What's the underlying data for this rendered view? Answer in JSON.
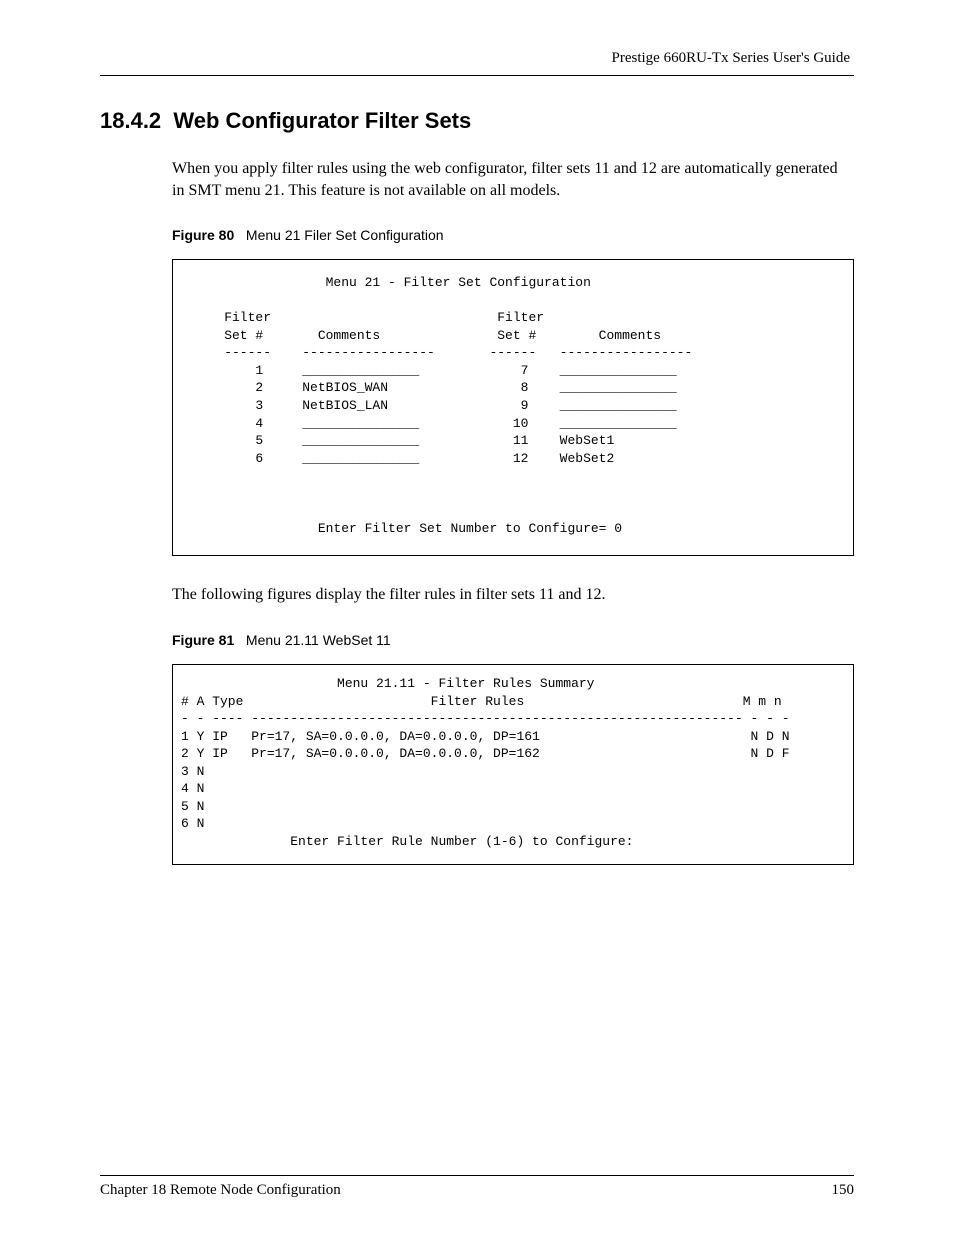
{
  "header": {
    "guide_title": "Prestige 660RU-Tx Series User's Guide"
  },
  "section": {
    "number": "18.4.2",
    "title": "Web Configurator Filter Sets"
  },
  "body": {
    "intro": "When you apply filter rules using the web configurator, filter sets 11 and 12 are automatically generated in SMT menu 21. This feature is not available on all models.",
    "after_fig80": "The following figures display the filter rules in filter sets 11 and 12."
  },
  "figures": {
    "fig80": {
      "label": "Figure 80",
      "caption": "Menu 21 Filer Set Configuration"
    },
    "fig81": {
      "label": "Figure 81",
      "caption": "Menu 21.11 WebSet 11"
    }
  },
  "terminal1": {
    "title": "Menu 21 - Filter Set Configuration",
    "col1_header": "Filter",
    "col1_header2": "Set #",
    "col2_header": "Comments",
    "col3_header": "Filter",
    "col3_header2": "Set #",
    "col4_header": "Comments",
    "rows_left": [
      {
        "num": "1",
        "comment": "_______________"
      },
      {
        "num": "2",
        "comment": "NetBIOS_WAN"
      },
      {
        "num": "3",
        "comment": "NetBIOS_LAN"
      },
      {
        "num": "4",
        "comment": "_______________"
      },
      {
        "num": "5",
        "comment": "_______________"
      },
      {
        "num": "6",
        "comment": "_______________"
      }
    ],
    "rows_right": [
      {
        "num": "7",
        "comment": "_______________"
      },
      {
        "num": "8",
        "comment": "_______________"
      },
      {
        "num": "9",
        "comment": "_______________"
      },
      {
        "num": "10",
        "comment": "_______________"
      },
      {
        "num": "11",
        "comment": "WebSet1"
      },
      {
        "num": "12",
        "comment": "WebSet2"
      }
    ],
    "prompt": "Enter Filter Set Number to Configure= 0"
  },
  "terminal2": {
    "title": "Menu 21.11 - Filter Rules Summary",
    "header_line": "# A Type                        Filter Rules                            M m n",
    "sep_line": "- - ---- --------------------------------------------------------------- - - -",
    "rows": [
      "1 Y IP   Pr=17, SA=0.0.0.0, DA=0.0.0.0, DP=161                           N D N",
      "2 Y IP   Pr=17, SA=0.0.0.0, DA=0.0.0.0, DP=162                           N D F",
      "3 N",
      "4 N",
      "5 N",
      "6 N"
    ],
    "prompt": "Enter Filter Rule Number (1-6) to Configure:"
  },
  "footer": {
    "chapter": "Chapter 18 Remote Node Configuration",
    "page": "150"
  }
}
